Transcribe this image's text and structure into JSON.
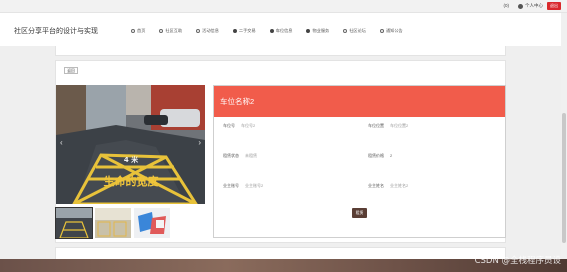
{
  "topbar": {
    "count_label": "0",
    "user_label": "个人中心",
    "exit_label": "退出"
  },
  "header": {
    "brand": "社区分享平台的设计与实现",
    "nav": [
      {
        "label": "首页",
        "icon": "home-icon"
      },
      {
        "label": "社区互助",
        "icon": "circle-icon"
      },
      {
        "label": "活动信息",
        "icon": "activity-icon"
      },
      {
        "label": "二手交易",
        "icon": "trade-icon"
      },
      {
        "label": "车位信息",
        "icon": "parking-icon"
      },
      {
        "label": "物业服务",
        "icon": "service-icon"
      },
      {
        "label": "社区论坛",
        "icon": "forum-icon"
      },
      {
        "label": "通知公告",
        "icon": "notice-icon"
      }
    ]
  },
  "detail": {
    "back_label": "返回",
    "title": "车位名称2",
    "fields": [
      {
        "key": "车位号",
        "value": "车位号2"
      },
      {
        "key": "车位位置",
        "value": "车位位置2"
      },
      {
        "key": "租赁状态",
        "value": "未租赁"
      },
      {
        "key": "租赁价格",
        "value": "2"
      },
      {
        "key": "业主账号",
        "value": "业主账号2"
      },
      {
        "key": "业主姓名",
        "value": "业主姓名2"
      }
    ],
    "book_label": "租赁"
  },
  "photo": {
    "sign_text_top": "4 米",
    "sign_text_bottom": "生命的宽度"
  },
  "watermark": "CSDN @全栈程序员设"
}
